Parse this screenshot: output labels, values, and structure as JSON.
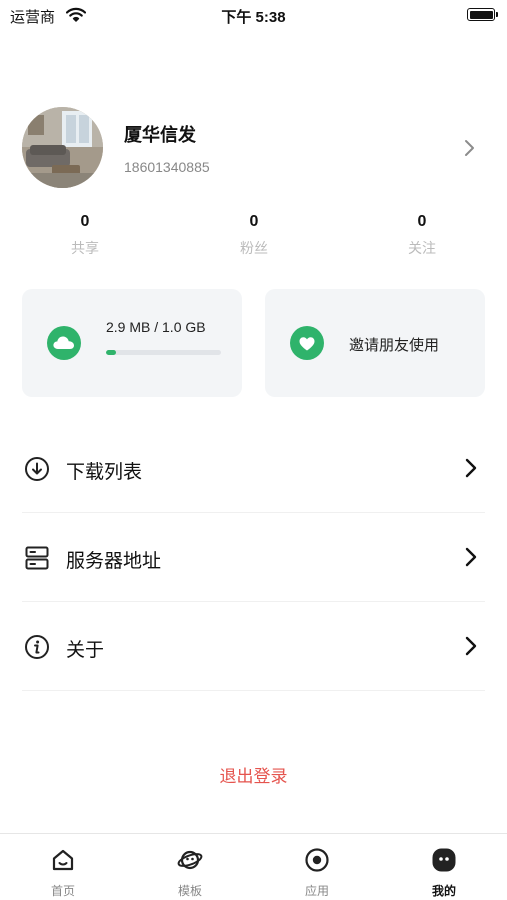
{
  "status_bar": {
    "carrier": "运营商",
    "time": "下午 5:38"
  },
  "profile": {
    "name": "厦华信发",
    "phone": "18601340885"
  },
  "stats": [
    {
      "value": "0",
      "label": "共享"
    },
    {
      "value": "0",
      "label": "粉丝"
    },
    {
      "value": "0",
      "label": "关注"
    }
  ],
  "storage_card": {
    "text": "2.9 MB / 1.0 GB",
    "used_fraction": 0.0028
  },
  "invite_card": {
    "text": "邀请朋友使用"
  },
  "menu": [
    {
      "label": "下载列表",
      "icon": "download-icon"
    },
    {
      "label": "服务器地址",
      "icon": "server-icon"
    },
    {
      "label": "关于",
      "icon": "info-icon"
    }
  ],
  "logout_label": "退出登录",
  "tabs": [
    {
      "label": "首页",
      "icon": "home-icon"
    },
    {
      "label": "模板",
      "icon": "planet-icon"
    },
    {
      "label": "应用",
      "icon": "target-icon"
    },
    {
      "label": "我的",
      "icon": "profile-face-icon",
      "active": true
    }
  ],
  "colors": {
    "accent": "#2fb36b",
    "logout": "#e5544e",
    "card_bg": "#f3f5f7"
  }
}
